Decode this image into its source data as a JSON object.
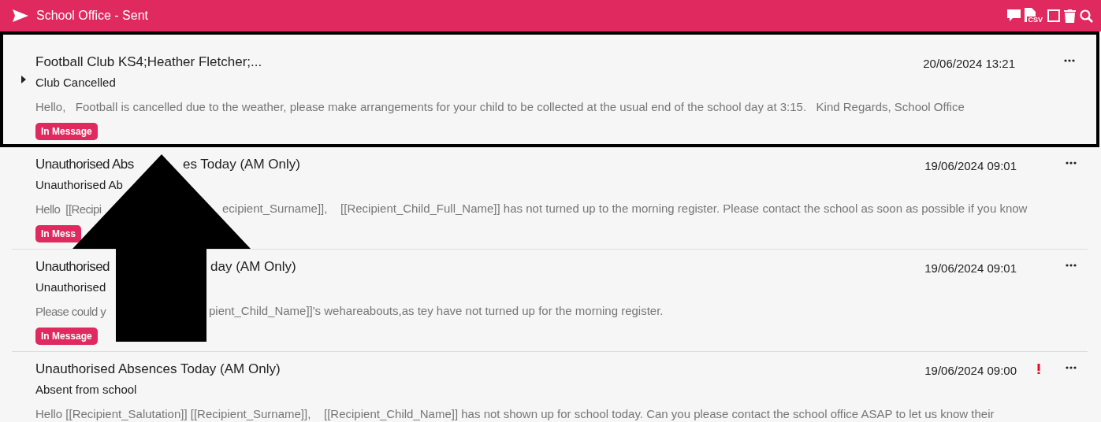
{
  "header": {
    "title": "School Office - Sent",
    "csv_label": "CSV"
  },
  "messages": [
    {
      "selected": true,
      "important": false,
      "title": [
        "Football Club KS4;Heather Fletcher;..."
      ],
      "subject": [
        "Club Cancelled"
      ],
      "body": [
        "Hello,   Football is cancelled due to the weather, please make arrangements for your child to be collected at the usual end of the school day at 3:15.   Kind Regards, School Office"
      ],
      "badge": "In Message",
      "date": "20/06/2024 13:21"
    },
    {
      "selected": false,
      "important": false,
      "title": [
        "Unauthorised Abs",
        "es Today (AM Only)"
      ],
      "subject": [
        "Unauthorised Ab"
      ],
      "body": [
        "Hello  [[Recipi",
        "ecipient_Surname]],    [[Recipient_Child_Full_Name]] has not turned up to the morning register. Please contact the school as soon as possible if you know"
      ],
      "badge": "In Mess",
      "date": "19/06/2024 09:01"
    },
    {
      "selected": false,
      "important": false,
      "title": [
        "Unauthorised",
        "day (AM Only)"
      ],
      "subject": [
        "Unauthorised"
      ],
      "body": [
        "Please could y",
        "pient_Child_Name]]'s wehareabouts,as tey have not turned up for the morning register."
      ],
      "badge": "In Message",
      "date": "19/06/2024 09:01"
    },
    {
      "selected": false,
      "important": true,
      "title": [
        "Unauthorised Absences Today (AM Only)"
      ],
      "subject": [
        "Absent from school"
      ],
      "body": [
        "Hello [[Recipient_Salutation]] [[Recipient_Surname]],    [[Recipient_Child_Name]] has not shown up for school today. Can you please contact the school office ASAP to let us know their"
      ],
      "date": "19/06/2024 09:00"
    }
  ]
}
